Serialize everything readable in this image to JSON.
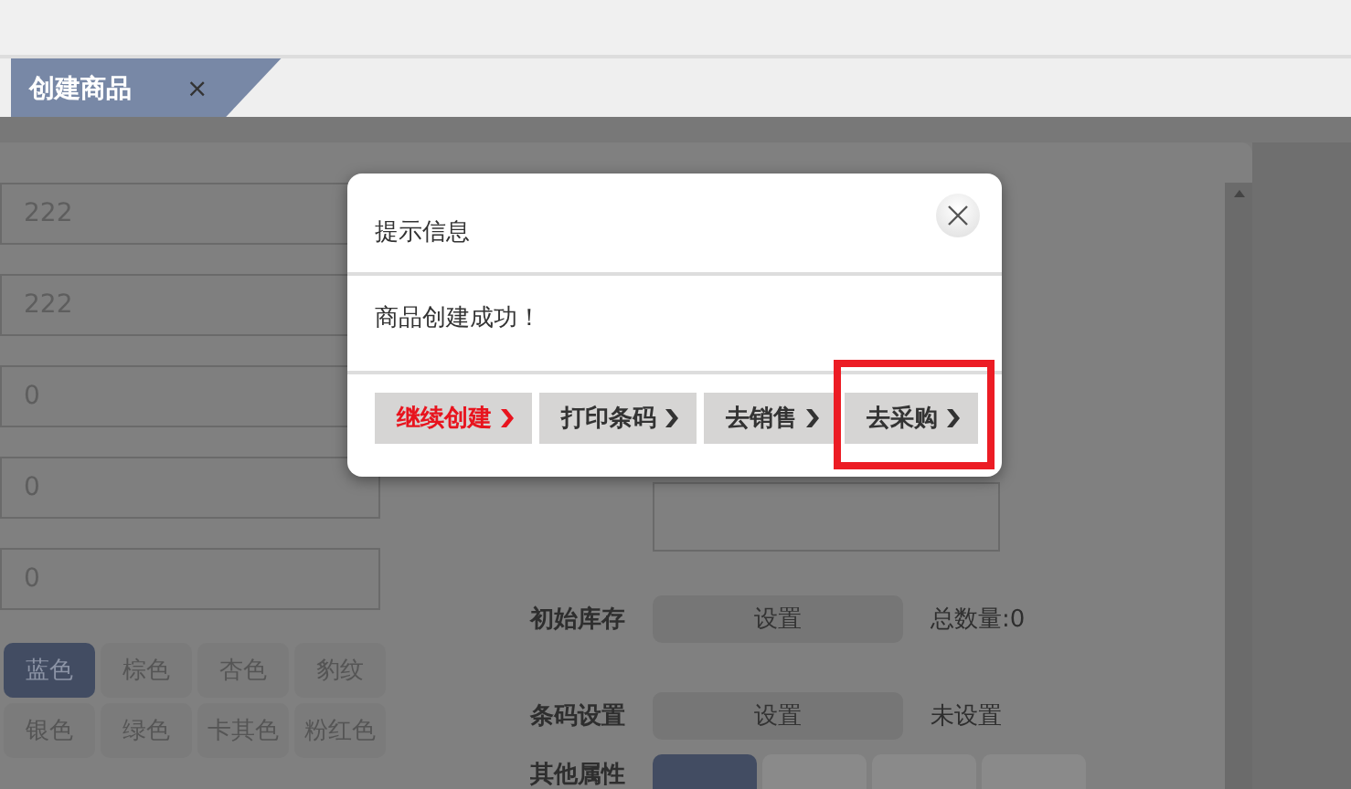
{
  "tabs": [
    {
      "label": "创建商品",
      "close": "×",
      "selected": true
    }
  ],
  "form": {
    "fields": [
      {
        "value": "222"
      },
      {
        "value": "222"
      },
      {
        "value": "0"
      },
      {
        "value": "0"
      },
      {
        "value": "0"
      }
    ],
    "colors": [
      {
        "label": "蓝色",
        "selected": true
      },
      {
        "label": "棕色",
        "selected": false
      },
      {
        "label": "杏色",
        "selected": false
      },
      {
        "label": "豹纹",
        "selected": false
      },
      {
        "label": "银色",
        "selected": false
      },
      {
        "label": "绿色",
        "selected": false
      },
      {
        "label": "卡其色",
        "selected": false
      },
      {
        "label": "粉红色",
        "selected": false
      }
    ],
    "settings": [
      {
        "label": "初始库存",
        "button": "设置",
        "status": "总数量:0"
      },
      {
        "label": "条码设置",
        "button": "设置",
        "status": "未设置"
      }
    ],
    "other": {
      "label": "其他属性",
      "options": [
        {
          "selected": true
        },
        {
          "selected": false
        },
        {
          "selected": false
        },
        {
          "selected": false
        }
      ]
    }
  },
  "dialog": {
    "title": "提示信息",
    "message": "商品创建成功！",
    "buttons": [
      {
        "label": "继续创建",
        "kind": "primary",
        "highlighted": false
      },
      {
        "label": "打印条码",
        "kind": "default",
        "highlighted": false
      },
      {
        "label": "去销售",
        "kind": "default",
        "highlighted": false
      },
      {
        "label": "去采购",
        "kind": "default",
        "highlighted": true
      }
    ]
  }
}
